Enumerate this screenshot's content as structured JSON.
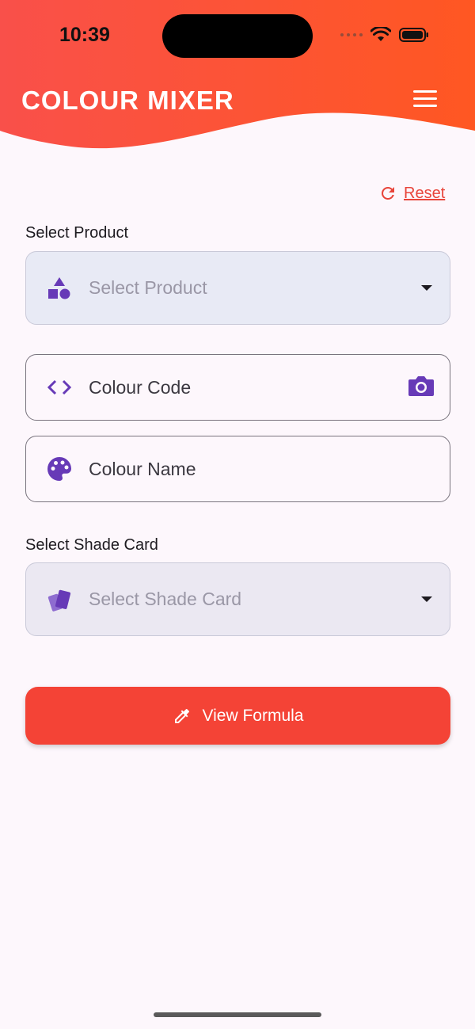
{
  "status_bar": {
    "time": "10:39"
  },
  "header": {
    "title": "COLOUR MIXER",
    "gradient_start": "#f9504a",
    "gradient_end": "#ff5722"
  },
  "reset": {
    "label": "Reset",
    "color": "#e8443a"
  },
  "product": {
    "section_label": "Select Product",
    "placeholder": "Select Product",
    "icon": "shapes-icon"
  },
  "colour_code": {
    "placeholder": "Colour Code",
    "icon": "code-icon",
    "trailing_icon": "camera-icon"
  },
  "colour_name": {
    "placeholder": "Colour Name",
    "icon": "palette-icon"
  },
  "shade_card": {
    "section_label": "Select Shade Card",
    "placeholder": "Select Shade Card",
    "icon": "swatch-cards-icon"
  },
  "view_formula": {
    "label": "View Formula",
    "icon": "eyedropper-icon",
    "color": "#f44336"
  },
  "accent_color": "#673ab7"
}
